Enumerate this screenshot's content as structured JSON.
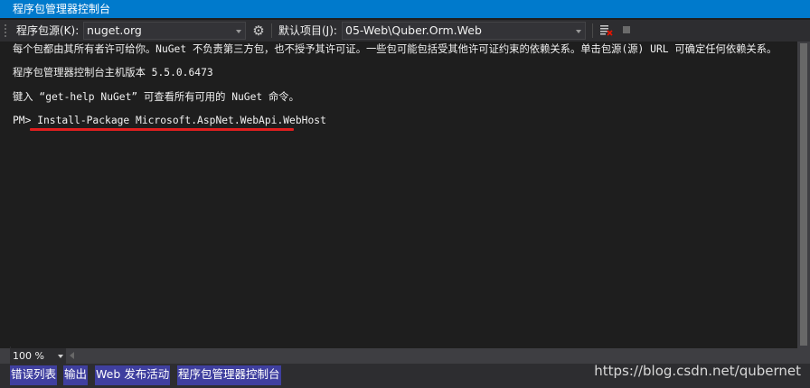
{
  "window": {
    "title": "程序包管理器控制台"
  },
  "toolbar": {
    "source_label": "程序包源(K):",
    "source_value": "nuget.org",
    "settings_icon": "gear-icon",
    "project_label": "默认项目(J):",
    "project_value": "05-Web\\Quber.Orm.Web",
    "clear_icon": "clear-console-icon",
    "stop_icon": "stop-icon"
  },
  "console": {
    "lines": [
      "每个包都由其所有者许可给你。NuGet 不负责第三方包，也不授予其许可证。一些包可能包括受其他许可证约束的依赖关系。单击包源(源) URL 可确定任何依赖关系。",
      "程序包管理器控制台主机版本 5.5.0.6473",
      "键入 “get-help NuGet” 可查看所有可用的 NuGet 命令。",
      "PM> Install-Package Microsoft.AspNet.WebApi.WebHost"
    ],
    "highlight_color": "#e11f1f"
  },
  "statusbar": {
    "zoom": "100 %"
  },
  "tabs": [
    {
      "label": "错误列表"
    },
    {
      "label": "输出"
    },
    {
      "label": "Web 发布活动"
    },
    {
      "label": "程序包管理器控制台"
    }
  ],
  "watermark": "https://blog.csdn.net/qubernet",
  "colors": {
    "accent": "#007acc",
    "background": "#1e1e1e",
    "tab_bg": "#3f3f9f"
  }
}
